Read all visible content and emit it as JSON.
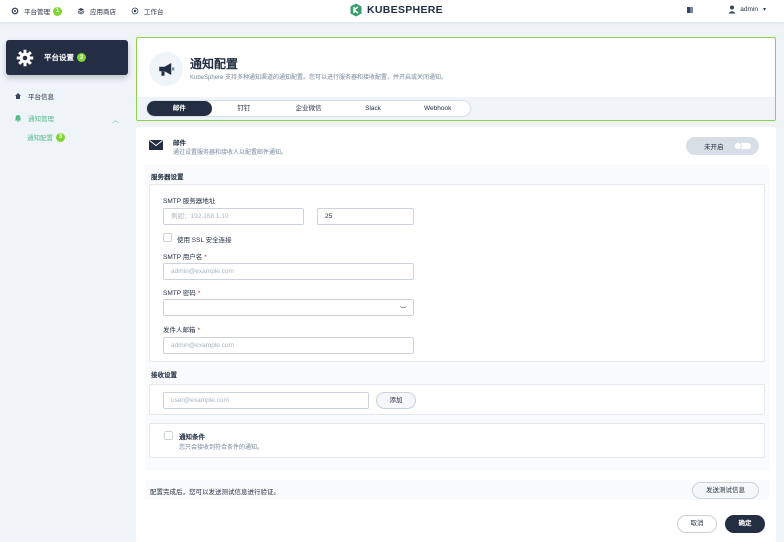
{
  "topbar": {
    "nav": [
      {
        "label": "平台管理",
        "icon": "gear-icon",
        "badge": "1"
      },
      {
        "label": "应用商店",
        "icon": "app-store-icon"
      },
      {
        "label": "工作台",
        "icon": "workbench-icon"
      }
    ],
    "logo_text": "KUBESPHERE",
    "user": "admin"
  },
  "sidebar": {
    "title": "平台设置",
    "title_badge": "2",
    "items": [
      {
        "label": "平台信息",
        "icon": "home-icon"
      },
      {
        "label": "通知管理",
        "icon": "bell-icon"
      }
    ],
    "sub_item": {
      "label": "通知配置",
      "badge": "3"
    }
  },
  "header": {
    "title": "通知配置",
    "description": "KubeSphere 支持多种通知渠道的通知配置。您可以进行服务器和接收配置，并开启或关闭通知。",
    "tabs": [
      "邮件",
      "钉钉",
      "企业微信",
      "Slack",
      "Webhook"
    ]
  },
  "email": {
    "title": "邮件",
    "description": "通过设置服务器和接收人以配置邮件通知。",
    "toggle_label": "未开启"
  },
  "server": {
    "section_label": "服务器设置",
    "smtp_address_label": "SMTP 服务器地址",
    "smtp_address_placeholder": "例如：192.168.1.10",
    "smtp_port": "25",
    "ssl_label": "使用 SSL 安全连接",
    "smtp_user_label": "SMTP 用户名",
    "smtp_user_placeholder": "admin@example.com",
    "smtp_password_label": "SMTP 密码",
    "sender_label": "发件人邮箱",
    "sender_placeholder": "admin@example.com",
    "required_mark": "*"
  },
  "receiver": {
    "section_label": "接收设置",
    "email_placeholder": "user@example.com",
    "add_label": "添加",
    "condition_title": "通知条件",
    "condition_desc": "您只会接收到符合条件的通知。"
  },
  "footer": {
    "verify_text": "配置完成后，您可以发送测试信息进行验证。",
    "verify_button": "发送测试信息",
    "cancel": "取消",
    "ok": "确定"
  },
  "colors": {
    "accent": "#55bc8a",
    "badge": "#7fd633",
    "dark": "#242e42",
    "highlight_border": "#8fd14f"
  }
}
